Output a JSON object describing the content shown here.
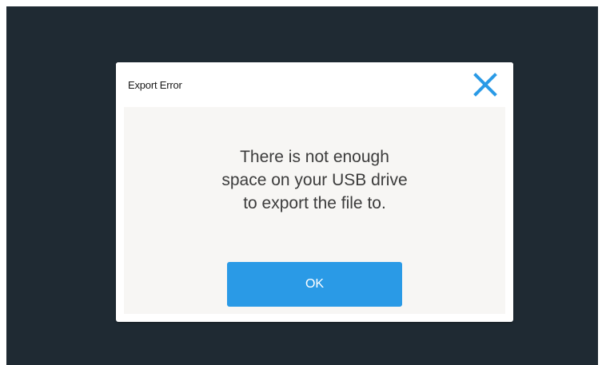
{
  "dialog": {
    "title": "Export Error",
    "close_icon": "close-icon",
    "message_lines": [
      "There is not enough",
      "space on your USB drive",
      "to export the file to."
    ],
    "ok_label": "OK"
  },
  "colors": {
    "backdrop": "#1f2a33",
    "accent": "#2a9ae6",
    "dialog_body": "#f7f6f4"
  }
}
